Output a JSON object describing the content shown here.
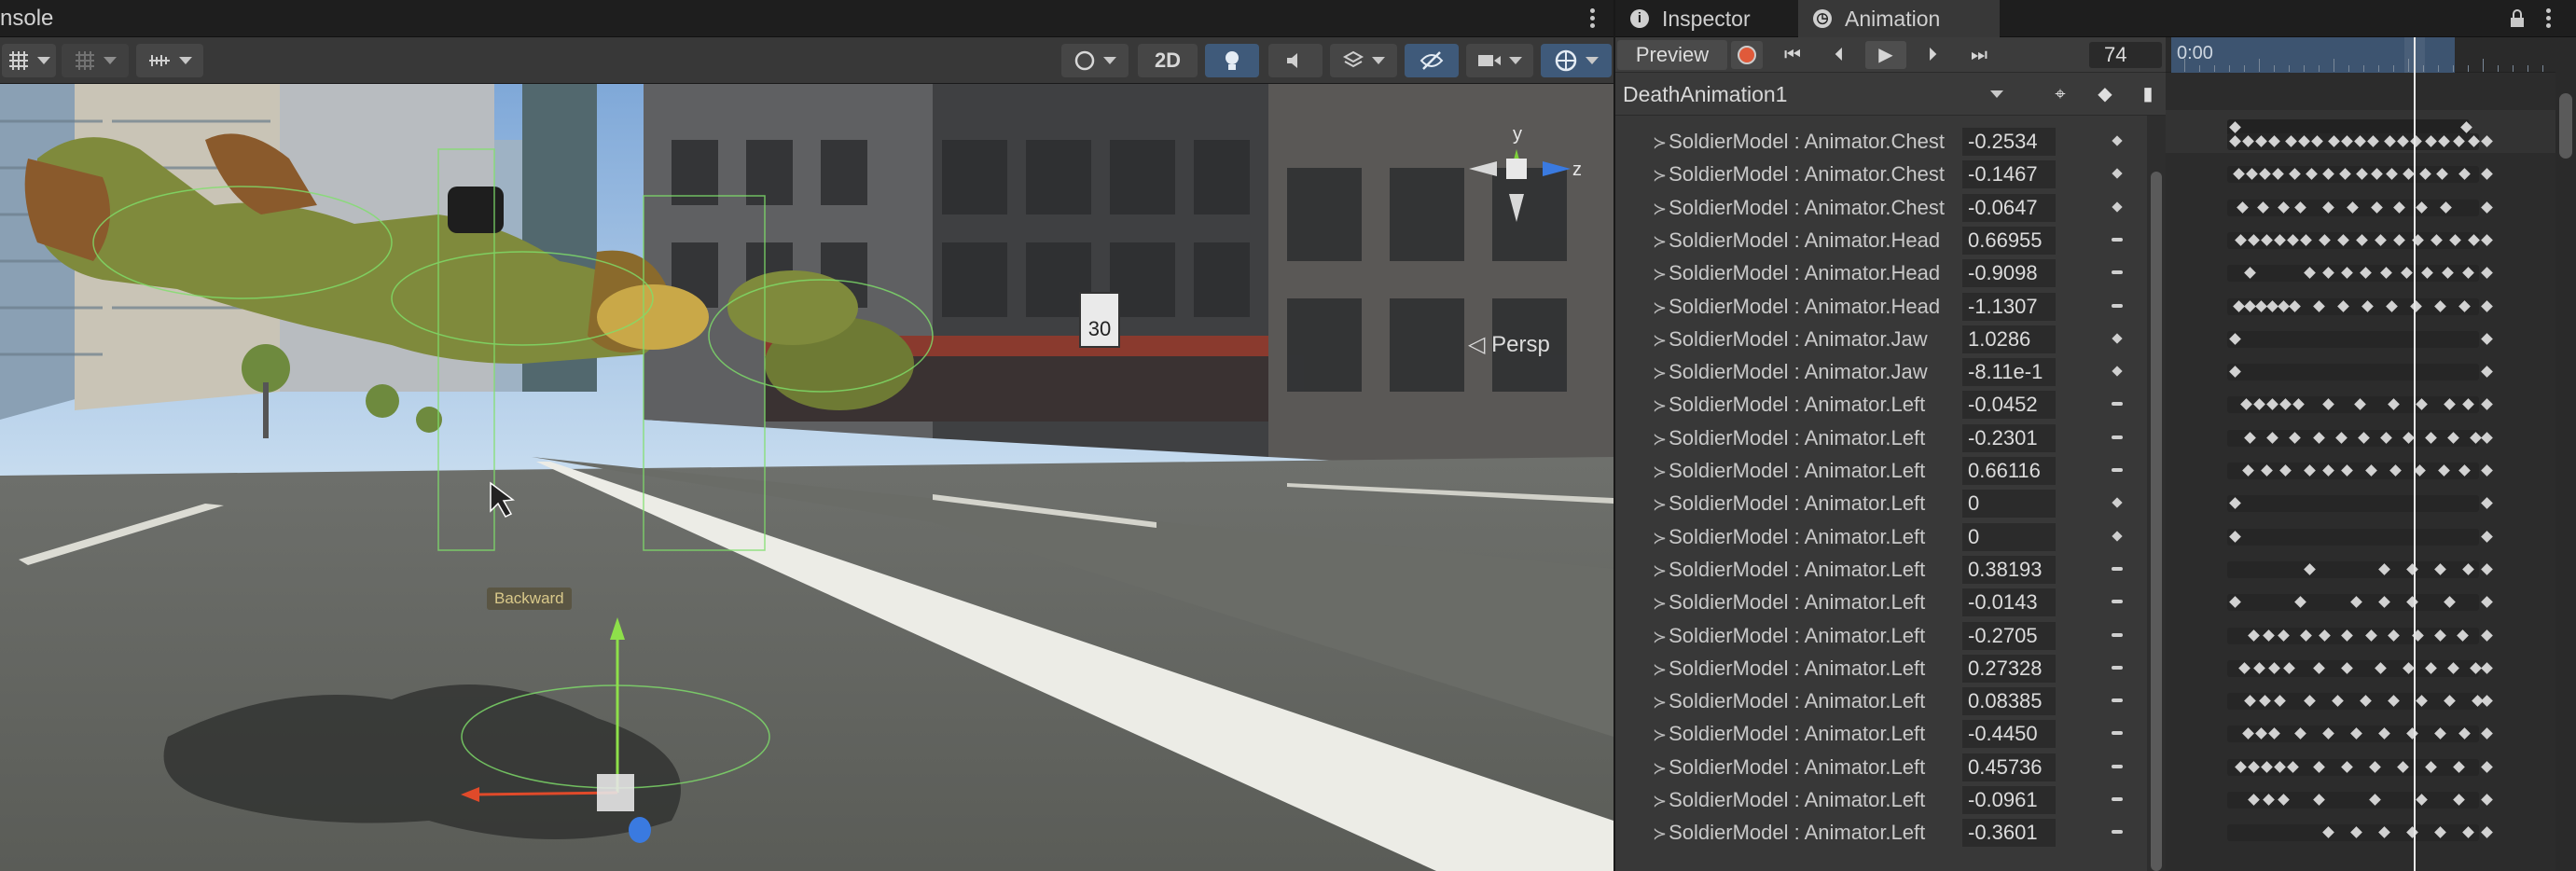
{
  "scene": {
    "tab_label": "nsole",
    "toolbar": {
      "mode_2d_label": "2D"
    },
    "viewport": {
      "projection_label": "Persp",
      "gizmo_y": "y",
      "gizmo_z": "z",
      "backward_label": "Backward",
      "speed_sign_text": "30"
    }
  },
  "animation": {
    "tabs": [
      {
        "label": "Inspector",
        "icon": "info-icon"
      },
      {
        "label": "Animation",
        "icon": "animation-icon"
      }
    ],
    "preview_label": "Preview",
    "frame": "74",
    "ruler_start": "0:00",
    "clip_name": "DeathAnimation1",
    "properties": [
      {
        "name": "SoldierModel : Animator.Chest",
        "value": "-0.2534"
      },
      {
        "name": "SoldierModel : Animator.Chest",
        "value": "-0.1467"
      },
      {
        "name": "SoldierModel : Animator.Chest",
        "value": "-0.0647"
      },
      {
        "name": "SoldierModel : Animator.Head",
        "value": "0.66955"
      },
      {
        "name": "SoldierModel : Animator.Head",
        "value": "-0.9098"
      },
      {
        "name": "SoldierModel : Animator.Head",
        "value": "-1.1307"
      },
      {
        "name": "SoldierModel : Animator.Jaw",
        "value": "1.0286"
      },
      {
        "name": "SoldierModel : Animator.Jaw",
        "value": "-8.11e-1"
      },
      {
        "name": "SoldierModel : Animator.Left",
        "value": "-0.0452"
      },
      {
        "name": "SoldierModel : Animator.Left",
        "value": "-0.2301"
      },
      {
        "name": "SoldierModel : Animator.Left",
        "value": "0.66116"
      },
      {
        "name": "SoldierModel : Animator.Left",
        "value": "0"
      },
      {
        "name": "SoldierModel : Animator.Left",
        "value": "0"
      },
      {
        "name": "SoldierModel : Animator.Left",
        "value": "0.38193"
      },
      {
        "name": "SoldierModel : Animator.Left",
        "value": "-0.0143"
      },
      {
        "name": "SoldierModel : Animator.Left",
        "value": "-0.2705"
      },
      {
        "name": "SoldierModel : Animator.Left",
        "value": "0.27328"
      },
      {
        "name": "SoldierModel : Animator.Left",
        "value": "0.08385"
      },
      {
        "name": "SoldierModel : Animator.Left",
        "value": "-0.4450"
      },
      {
        "name": "SoldierModel : Animator.Left",
        "value": "0.45736"
      },
      {
        "name": "SoldierModel : Animator.Left",
        "value": "-0.0961"
      },
      {
        "name": "SoldierModel : Animator.Left",
        "value": "-0.3601"
      }
    ]
  },
  "colors": {
    "accent_blue": "#3f5a7a",
    "record_red": "#e05a3a",
    "gizmo_y": "#7ed13a",
    "gizmo_z": "#3a7ae0",
    "gizmo_x": "#e04a2a"
  }
}
